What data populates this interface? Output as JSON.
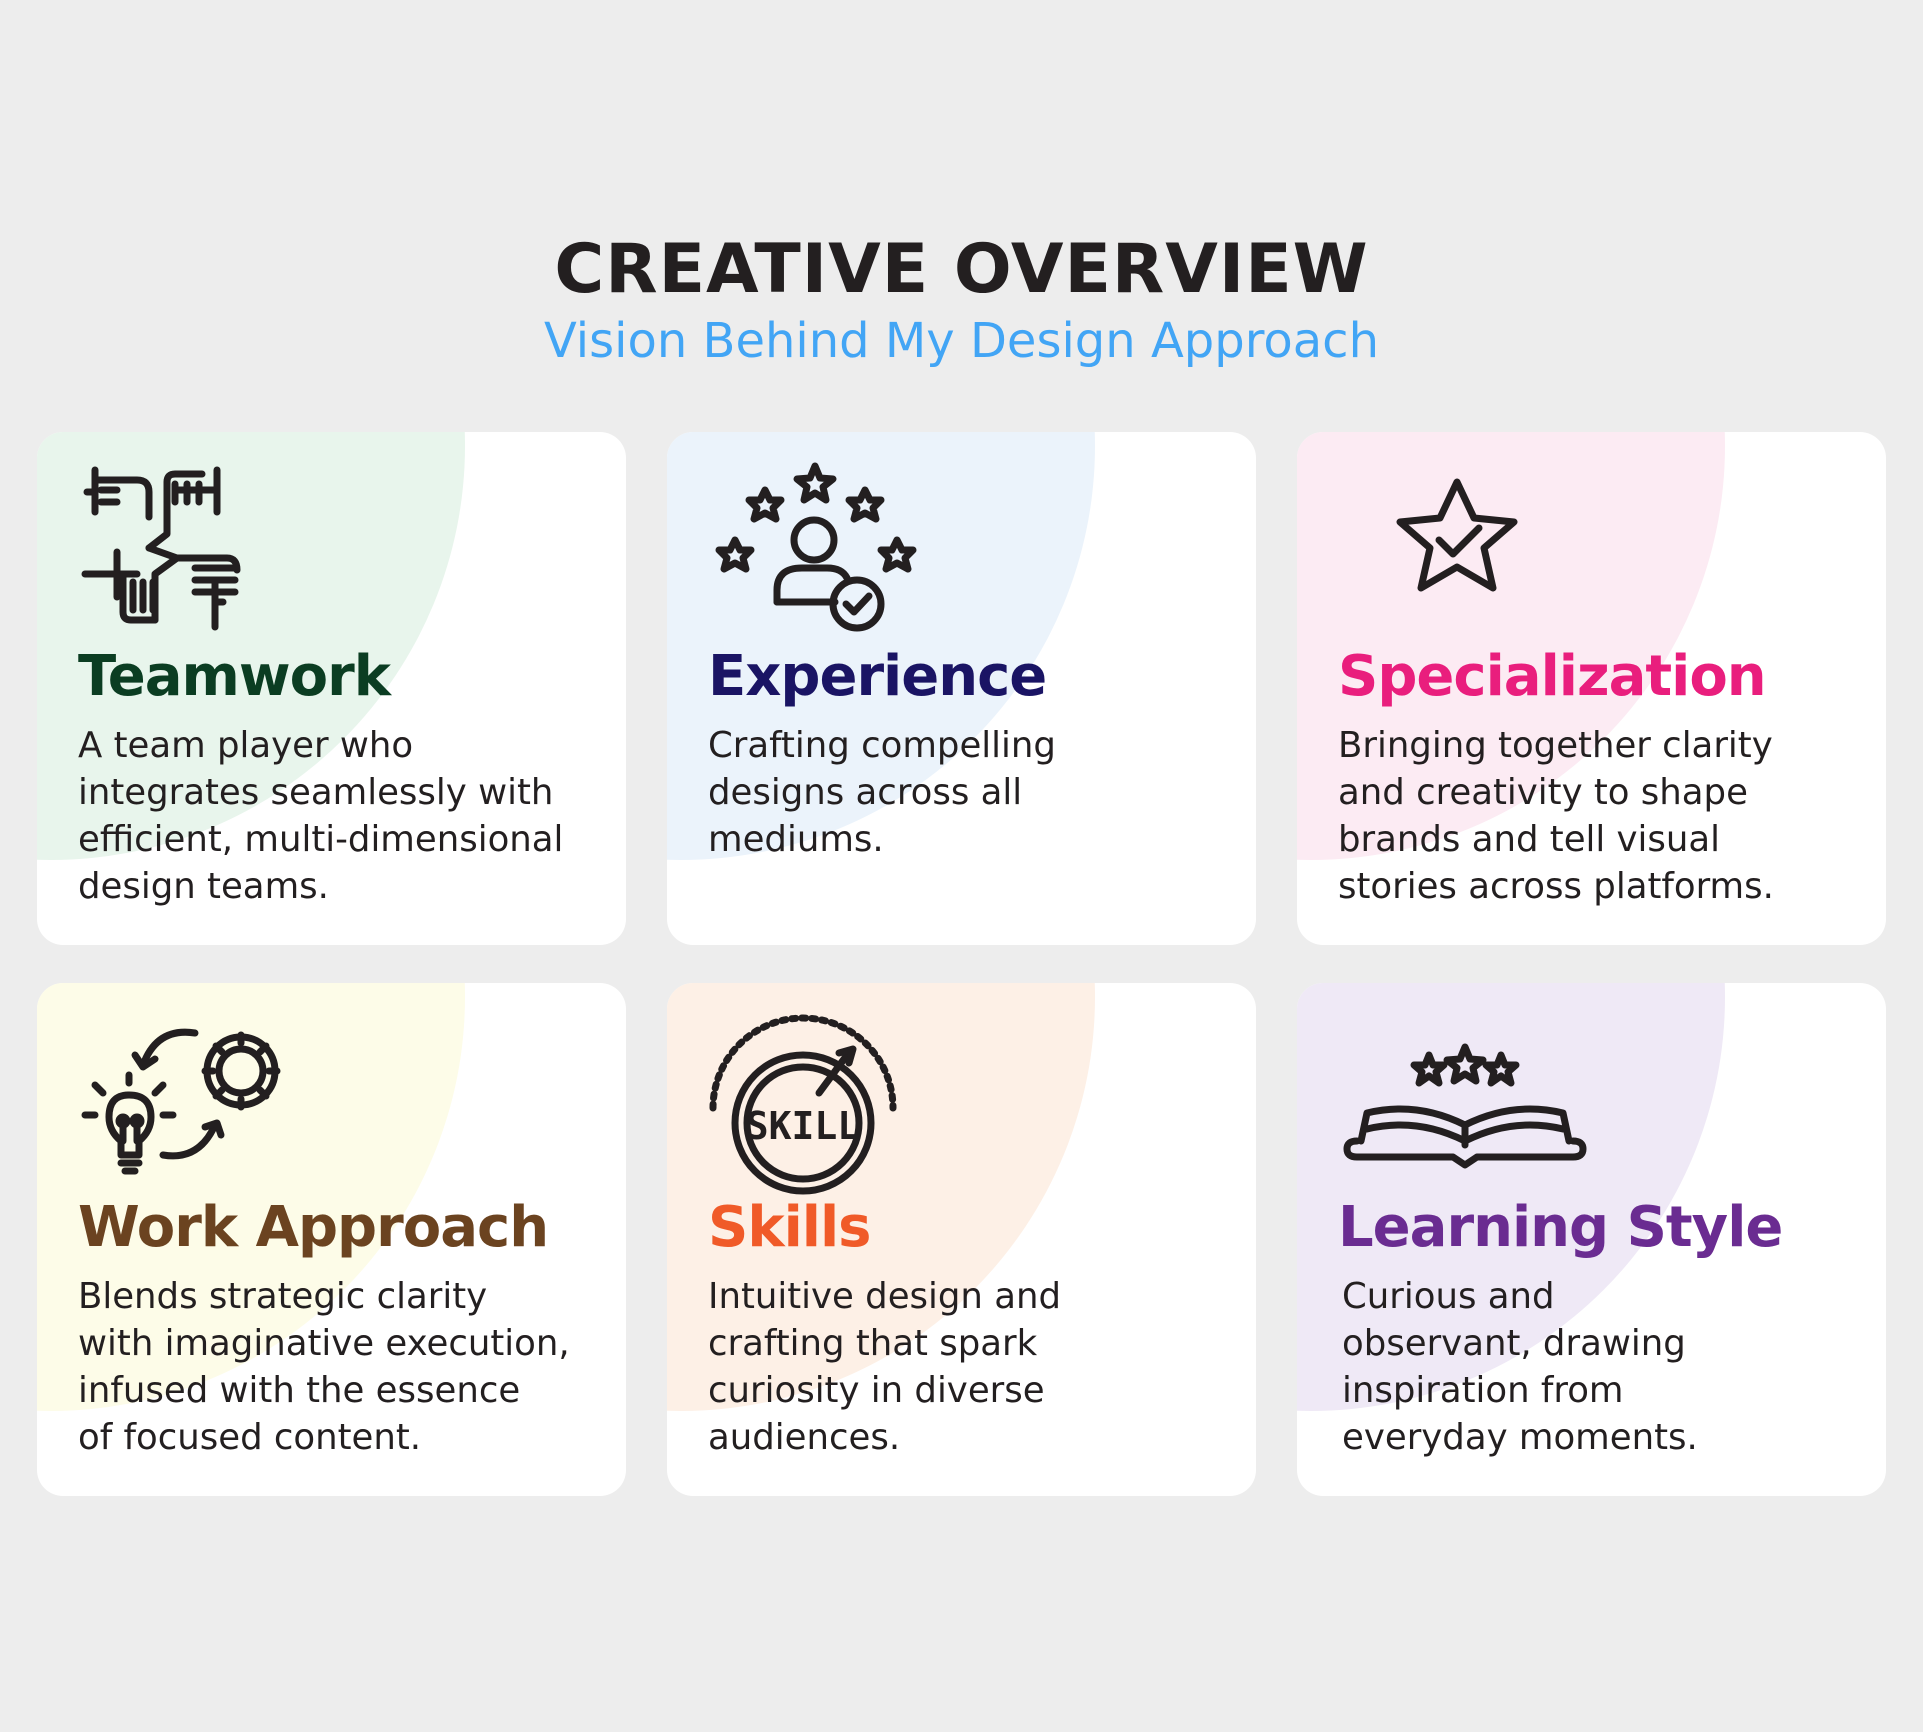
{
  "header": {
    "title": "CREATIVE OVERVIEW",
    "subtitle": "Vision Behind My Design Approach"
  },
  "colors": {
    "background": "#ededed",
    "title": "#231f20",
    "subtitle": "#42a5f5",
    "body_text": "#231f20"
  },
  "cards": [
    {
      "title": "Teamwork",
      "description": "A team player who\nintegrates seamlessly with\nefficient, multi-dimensional\ndesign teams.",
      "title_color": "#0b3d22",
      "blob_color": "#e8f5ec",
      "icon": "four-hands-teamwork-icon"
    },
    {
      "title": "Experience",
      "description": "Crafting compelling\ndesigns across all\nmediums.",
      "title_color": "#1a1464",
      "blob_color": "#ebf3fb",
      "icon": "person-with-stars-check-icon"
    },
    {
      "title": "Specialization",
      "description": "Bringing together clarity\nand creativity to shape\nbrands and tell visual\nstories across platforms.",
      "title_color": "#e91e7d",
      "blob_color": "#fcebf3",
      "icon": "star-check-icon"
    },
    {
      "title": "Work Approach",
      "description": "Blends strategic clarity\nwith imaginative execution,\ninfused with the essence\nof focused content.",
      "title_color": "#6b4320",
      "blob_color": "#fdfce8",
      "icon": "lightbulb-gear-cycle-icon"
    },
    {
      "title": "Skills",
      "description": "Intuitive design and\ncrafting that spark\ncuriosity in diverse\naudiences.",
      "title_color": "#f05a28",
      "blob_color": "#fdf0e6",
      "icon": "skill-gauge-icon",
      "icon_text": "SKILL"
    },
    {
      "title": "Learning Style",
      "description": "Curious and\nobservant, drawing\ninspiration from\neveryday moments.",
      "title_color": "#6a2c91",
      "blob_color": "#efe9f6",
      "icon": "open-book-stars-icon"
    }
  ]
}
